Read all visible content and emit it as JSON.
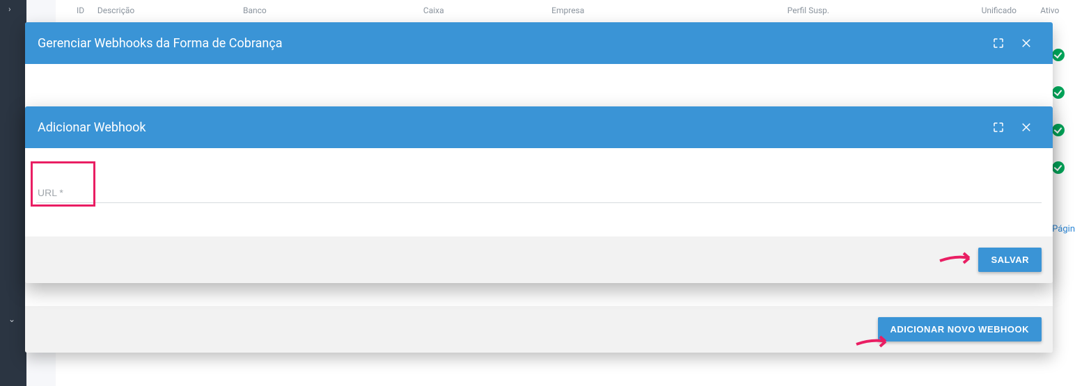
{
  "table": {
    "headers": {
      "id": "ID",
      "descricao": "Descrição",
      "banco": "Banco",
      "caixa": "Caixa",
      "empresa": "Empresa",
      "perfil_susp": "Perfil Susp.",
      "unificado": "Unificado",
      "ativo": "Ativo"
    },
    "pagination_label": "Págin"
  },
  "modal_outer": {
    "title": "Gerenciar Webhooks da Forma de Cobrança",
    "add_button": "ADICIONAR NOVO WEBHOOK"
  },
  "modal_inner": {
    "title": "Adicionar Webhook",
    "url_placeholder": "URL *",
    "save_button": "SALVAR"
  }
}
